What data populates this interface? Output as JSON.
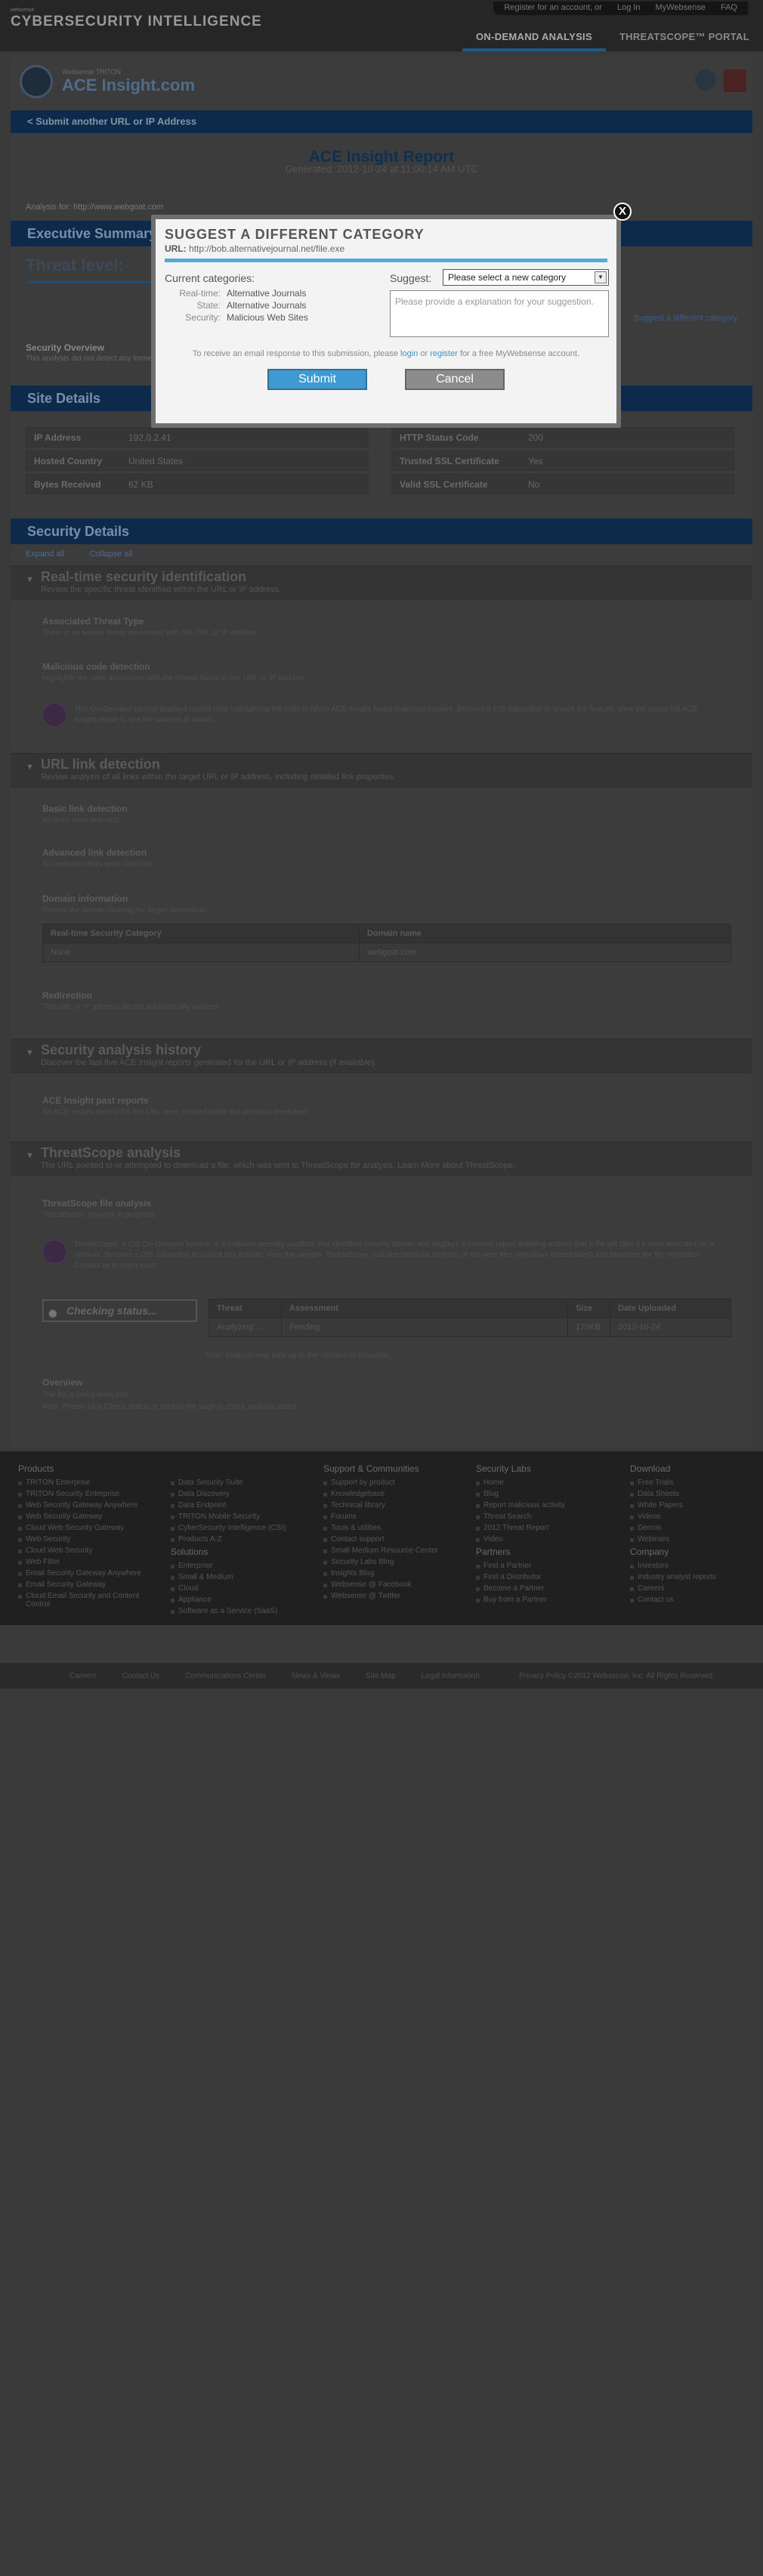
{
  "header": {
    "brand_small": "websense",
    "brand": "CYBERSECURITY INTELLIGENCE",
    "top_links": [
      "Register for an account, or",
      "Log In",
      "MyWebsense",
      "FAQ"
    ],
    "nav": [
      "ON-DEMAND ANALYSIS",
      "THREATSCOPE™ PORTAL"
    ]
  },
  "logo": {
    "sub": "Websense TRITON",
    "main": "ACE Insight.com"
  },
  "submit_bar": "< Submit another URL or IP Address",
  "report": {
    "title": "ACE Insight Report",
    "generated": "Generated: 2012-10-24 at 11:00:14 AM UTC",
    "analysis_for": "Analysis for:   http://www.webgoat.com"
  },
  "executive": {
    "title": "Executive Summary",
    "threat": "Threat level:",
    "rt_link": "Suggest a different category",
    "overview_title": "Security Overview",
    "overview_text": "This analysis did not detect any immediate threats."
  },
  "site_details": {
    "title": "Site Details",
    "left": [
      {
        "k": "IP Address",
        "v": "192.0.2.41"
      },
      {
        "k": "Hosted Country",
        "v": "United States"
      },
      {
        "k": "Bytes Received",
        "v": "62 KB"
      }
    ],
    "right": [
      {
        "k": "HTTP Status Code",
        "v": "200"
      },
      {
        "k": "Trusted SSL Certificate",
        "v": "Yes"
      },
      {
        "k": "Valid SSL Certificate",
        "v": "No"
      }
    ]
  },
  "security_details": {
    "title": "Security Details",
    "expand": "Expand all",
    "collapse": "Collapse all",
    "rt": {
      "title": "Real-time security identification",
      "subtitle": "Review the specific threat identified within the URL or IP address.",
      "h1": "Associated Threat Type",
      "t1": "There is no known threat associated with this URL or IP address.",
      "h2": "Malicious code detection",
      "t2": "Highlights the code associated with the threats found in this URL or IP address.",
      "lock_text": "This On-Demand service displays results only, highlighting the code in which ACE Insight found malicious content. Become a CIS subscriber to unlock the feature. View the actual full ACE Insight report to see the sources in action."
    },
    "url": {
      "title": "URL link detection",
      "subtitle": "Review analysis of all links within the target URL or IP address, including detailed link properties.",
      "h1": "Basic link detection",
      "t1": "No links were detected.",
      "h2": "Advanced link detection",
      "t2": "No malicious links were detected.",
      "h3": "Domain information",
      "t3": "Review the domain hosting the target destination.",
      "col1": "Real-time Security Category",
      "col2": "Domain name",
      "row1": "None",
      "row2": "webgoat.com",
      "h4": "Redirection",
      "t4": "The URL or IP address did not automatically redirect."
    },
    "history": {
      "title": "Security analysis history",
      "subtitle": "Discover the last five ACE Insight reports generated for the URL or IP address (if available).",
      "h1": "ACE Insight past reports",
      "t1": "No ACE Insight reports for this URL were created within the previous timeframe."
    },
    "threatscope": {
      "title": "ThreatScope analysis",
      "subtitle": "The URL pointed to or attempted to download a file, which was sent to ThreatScope for analysis. Learn More about ThreatScope.",
      "h1": "ThreatScope file analysis",
      "t1": "ThreatScope analysis in progress.",
      "lock_text": "ThreatScope, a CIS On-Demand service, is a malware security sandbox that identifies security threats and displays a forensic report detailing actions that a file will take if it were executed on a network. Become a CIS subscriber to unlock this feature. View the sample. ThreatScope includes behavior analysis of run-time files (Windows executables) and identifies the file reputation. Contact us to learn more.",
      "checking": "Checking status...",
      "table_headers": [
        "Threat",
        "Assessment",
        "Size",
        "Date Uploaded"
      ],
      "table_row": [
        "Analyzing ...",
        "Pending",
        "170KB",
        "2012-10-24"
      ],
      "note": "Note: Analysis may take up to five minutes to complete.",
      "ov_title": "Overview",
      "ov_text": "The file is being analyzed.",
      "ov_note": "Note: Please click Check Status or refresh the page to check analysis status."
    }
  },
  "footer": {
    "products": {
      "title": "Products",
      "items": [
        "TRITON Enterprise",
        "TRITON Security Enterprise",
        "Web Security Gateway Anywhere",
        "Web Security Gateway",
        "Cloud Web Security Gateway",
        "Web Security",
        "Cloud Web Security",
        "Web Filter",
        "Email Security Gateway Anywhere",
        "Email Security Gateway",
        "Cloud Email Security and Content Control"
      ]
    },
    "col2": {
      "items": [
        "Data Security Suite",
        "Data Discovery",
        "Data Endpoint",
        "TRITON Mobile Security",
        "CyberSecurity Intelligence (CSI)",
        "Products A-Z"
      ],
      "solutions_title": "Solutions",
      "solutions": [
        "Enterprise",
        "Small & Medium",
        "Cloud",
        "Appliance",
        "Software as a Service (SaaS)"
      ]
    },
    "support": {
      "title": "Support & Communities",
      "items": [
        "Support by product",
        "Knowledgebase",
        "Technical library",
        "Forums",
        "Tools & utilities",
        "Contact support",
        "Small Medium Resource Center",
        "Security Labs Blog",
        "Insights Blog",
        "Websense @ Facebook",
        "Websense @ Twitter"
      ]
    },
    "labs": {
      "title": "Security Labs",
      "items": [
        "Home",
        "Blog",
        "Report malicious activity",
        "Threat Search",
        "2012 Threat Report",
        "Video"
      ],
      "partners_title": "Partners",
      "partners": [
        "Find a Partner",
        "Find a Distributor",
        "Become a Partner",
        "Buy from a Partner"
      ]
    },
    "download": {
      "title": "Download",
      "items": [
        "Free Trials",
        "Data Sheets",
        "White Papers",
        "Videos",
        "Demos",
        "Webinars"
      ],
      "company_title": "Company",
      "company": [
        "Investors",
        "Industry analyst reports",
        "Careers",
        "Contact us"
      ]
    },
    "bottom_links": [
      "Careers",
      "Contact Us",
      "Communications Center",
      "News & Views",
      "Site Map",
      "Legal Information"
    ],
    "copyright": "Privacy Policy ©2012 Websense, Inc. All Rights Reserved."
  },
  "modal": {
    "title": "SUGGEST A DIFFERENT CATEGORY",
    "url_label": "URL:",
    "url": "http://bob.alternativejournal.net/file.exe",
    "current_title": "Current categories:",
    "categories": [
      {
        "k": "Real-time:",
        "v": "Alternative Journals"
      },
      {
        "k": "State:",
        "v": "Alternative Journals"
      },
      {
        "k": "Security:",
        "v": "Malicious Web Sites"
      }
    ],
    "suggest_label": "Suggest:",
    "select_value": "Please select a new category",
    "explain_placeholder": "Please provide a explanation for your suggestion.",
    "email_pre": "To receive an email response to this submission, please",
    "login": "login",
    "or": "or",
    "register": "register",
    "email_post": "for a free MyWebsense account.",
    "submit": "Submit",
    "cancel": "Cancel",
    "close": "X"
  }
}
